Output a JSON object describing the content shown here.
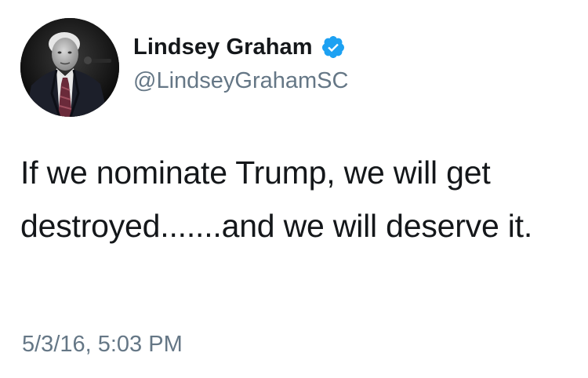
{
  "author": {
    "display_name": "Lindsey Graham",
    "handle": "@LindseyGrahamSC",
    "verified": true,
    "avatar_icon": "profile-photo"
  },
  "tweet": {
    "text": "If we nominate Trump, we will get destroyed.......and we will deserve it.",
    "timestamp": "5/3/16, 5:03 PM"
  },
  "colors": {
    "text": "#14171a",
    "secondary": "#657786",
    "verified_badge": "#1da1f2",
    "background": "#ffffff"
  }
}
